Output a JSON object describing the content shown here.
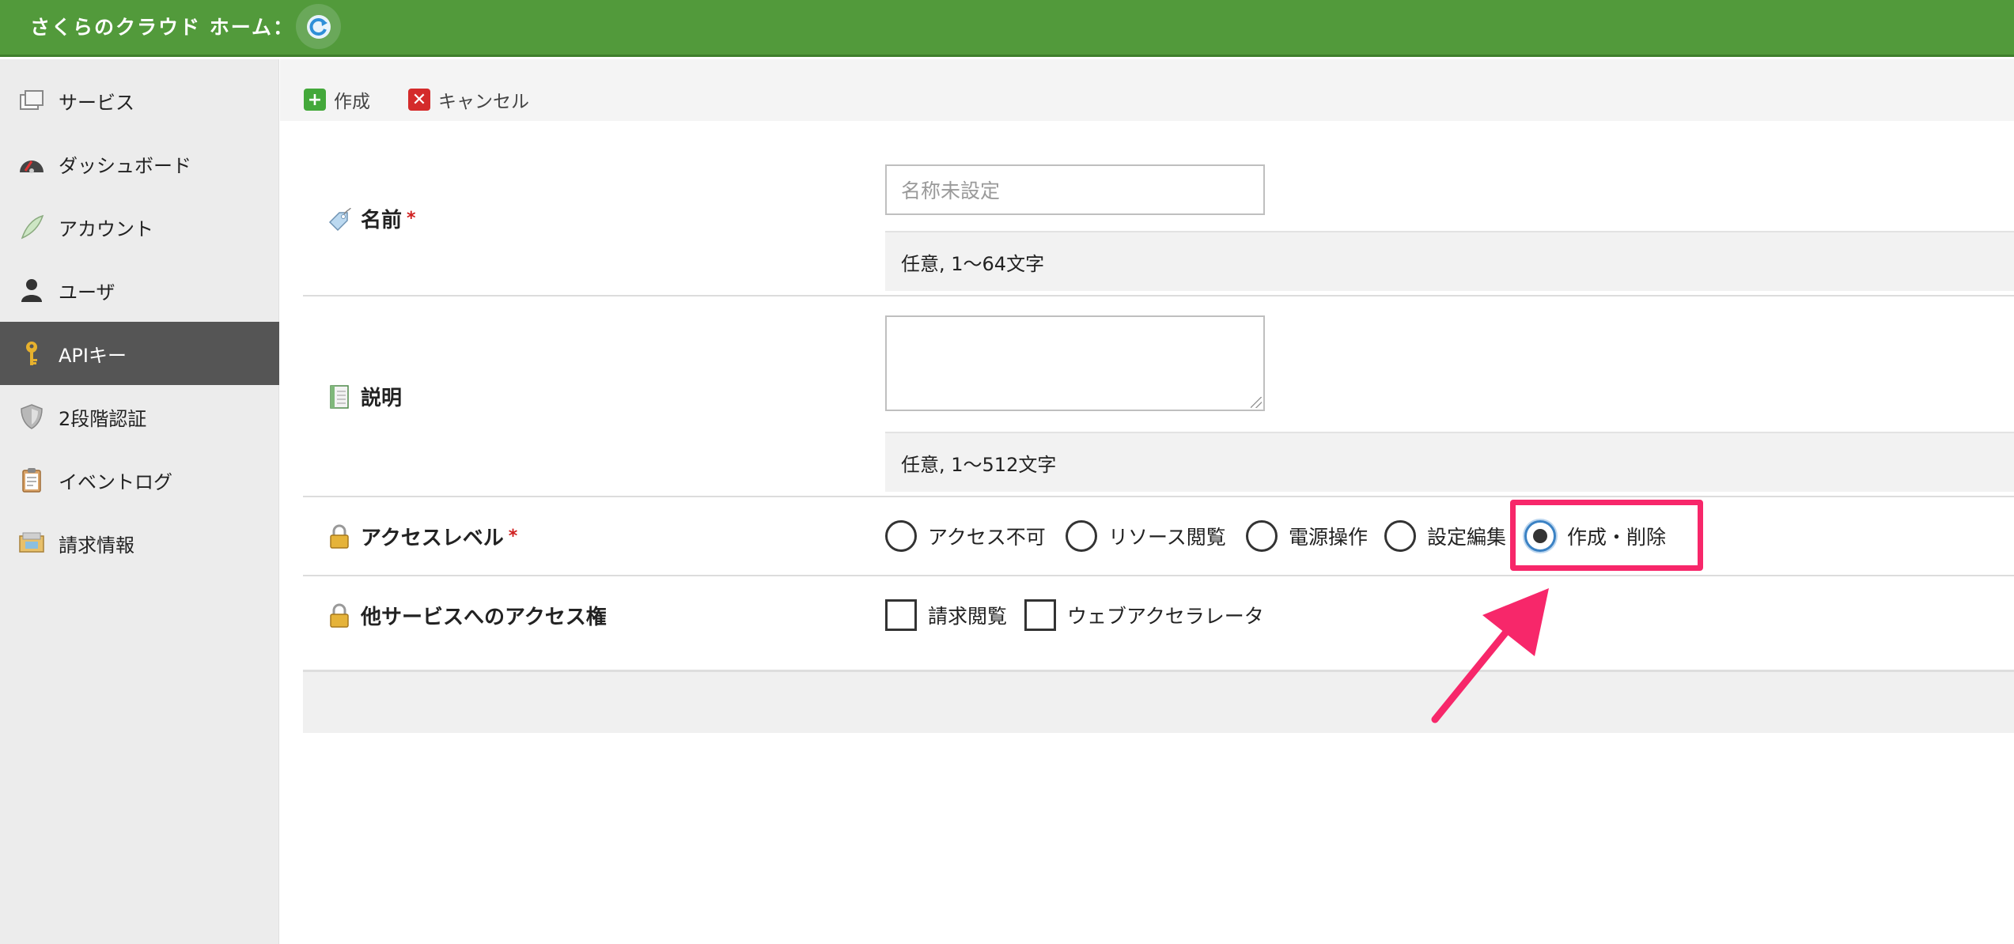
{
  "header": {
    "title": "さくらのクラウド ホーム：",
    "refresh_icon": "refresh-icon"
  },
  "sidebar": {
    "items": [
      {
        "label": "サービス",
        "icon": "services-icon"
      },
      {
        "label": "ダッシュボード",
        "icon": "dashboard-icon"
      },
      {
        "label": "アカウント",
        "icon": "feather-icon"
      },
      {
        "label": "ユーザ",
        "icon": "user-icon"
      },
      {
        "label": "APIキー",
        "icon": "key-icon",
        "active": true
      },
      {
        "label": "2段階認証",
        "icon": "shield-icon"
      },
      {
        "label": "イベントログ",
        "icon": "clipboard-icon"
      },
      {
        "label": "請求情報",
        "icon": "billing-icon"
      }
    ]
  },
  "toolbar": {
    "create_label": "作成",
    "cancel_label": "キャンセル"
  },
  "form": {
    "name": {
      "label": "名前",
      "required_mark": "*",
      "placeholder": "名称未設定",
      "hint": "任意, 1〜64文字"
    },
    "description": {
      "label": "説明",
      "hint": "任意, 1〜512文字"
    },
    "access_level": {
      "label": "アクセスレベル",
      "required_mark": "*",
      "options": [
        "アクセス不可",
        "リソース閲覧",
        "電源操作",
        "設定編集",
        "作成・削除"
      ],
      "selected": "作成・削除"
    },
    "other_access": {
      "label": "他サービスへのアクセス権",
      "options": [
        "請求閲覧",
        "ウェブアクセラレータ"
      ]
    }
  },
  "colors": {
    "header": "#529a3b",
    "highlight": "#f7276a",
    "active_nav": "#555555"
  }
}
